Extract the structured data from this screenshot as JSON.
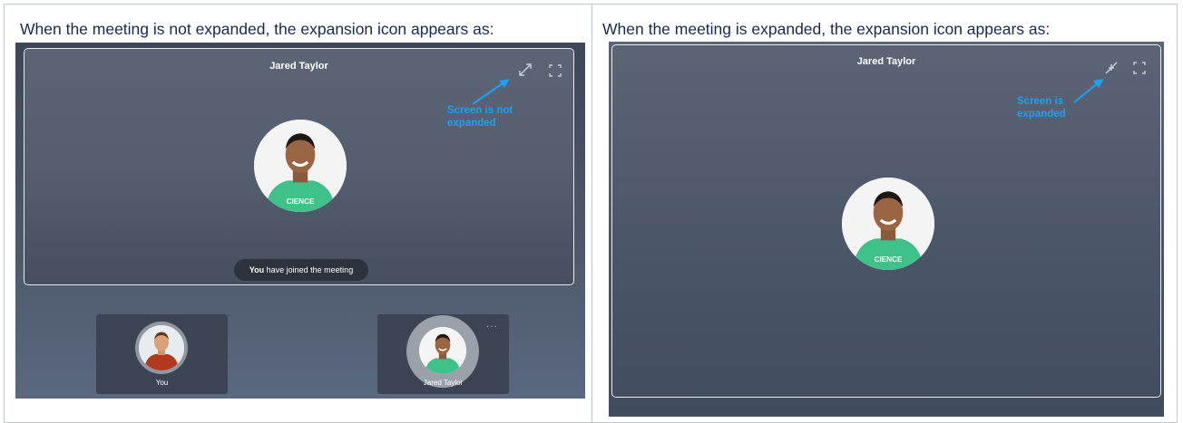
{
  "left_panel": {
    "caption": "When the meeting is not expanded, the expansion icon appears as:",
    "participant_name": "Jared Taylor",
    "annotation": "Screen is not\nexpanded",
    "toast_bold": "You",
    "toast_rest": " have joined the meeting",
    "tiles": [
      {
        "label": "You"
      },
      {
        "label": "Jared Taylor"
      }
    ],
    "tile_menu": "···"
  },
  "right_panel": {
    "caption": "When the meeting is expanded, the expansion icon appears as:",
    "participant_name": "Jared Taylor",
    "annotation": "Screen is\nexpanded"
  },
  "colors": {
    "annotation": "#1da1f2",
    "shirt": "#3ec28a",
    "border": "#c1c7d0"
  },
  "icons": [
    "expand-icon",
    "collapse-icon",
    "fullscreen-icon",
    "more-icon"
  ]
}
